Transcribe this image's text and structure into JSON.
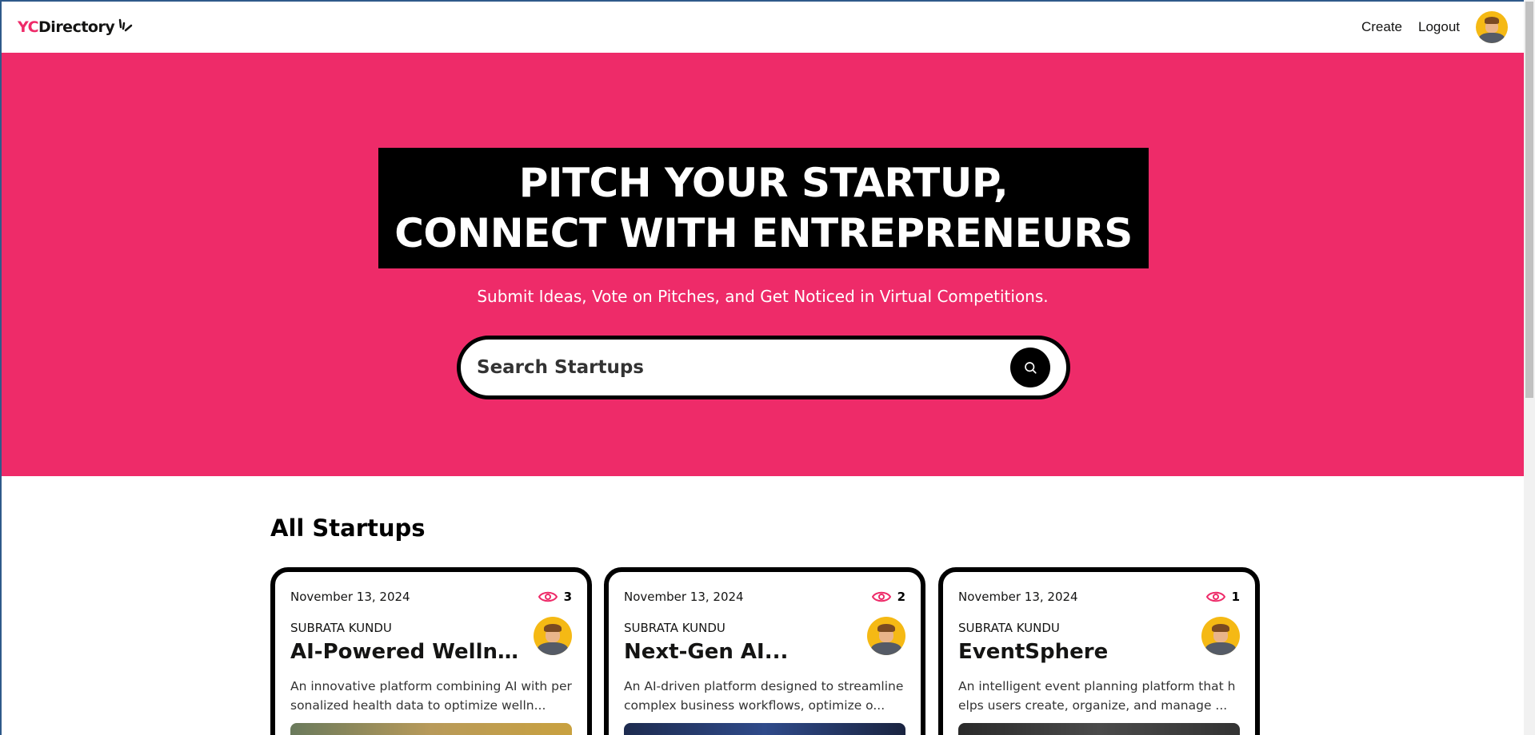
{
  "brand": {
    "yc": "YC",
    "directory": "Directory",
    "accent": "#ee2b69"
  },
  "nav": {
    "create": "Create",
    "logout": "Logout"
  },
  "hero": {
    "line1": "Pitch Your Startup,",
    "line2": "Connect With Entrepreneurs",
    "subtitle": "Submit Ideas, Vote on Pitches, and Get Noticed in Virtual Competitions.",
    "search_placeholder": "Search Startups"
  },
  "section": {
    "title": "All Startups"
  },
  "cards": [
    {
      "date": "November 13, 2024",
      "views": "3",
      "author": "SUBRATA KUNDU",
      "title": "AI-Powered Wellne...",
      "description": "An innovative platform combining AI with personalized health data to optimize welln..."
    },
    {
      "date": "November 13, 2024",
      "views": "2",
      "author": "SUBRATA KUNDU",
      "title": "Next-Gen AI...",
      "description": "An AI-driven platform designed to streamline complex business workflows, optimize o..."
    },
    {
      "date": "November 13, 2024",
      "views": "1",
      "author": "SUBRATA KUNDU",
      "title": "EventSphere",
      "description": "An intelligent event planning platform that helps users create, organize, and manage ..."
    }
  ]
}
